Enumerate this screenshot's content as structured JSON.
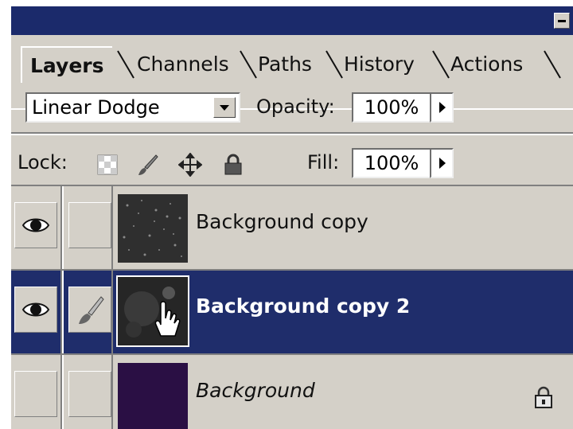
{
  "tabs": [
    {
      "label": "Layers",
      "active": true
    },
    {
      "label": "Channels",
      "active": false
    },
    {
      "label": "Paths",
      "active": false
    },
    {
      "label": "History",
      "active": false
    },
    {
      "label": "Actions",
      "active": false
    }
  ],
  "blend_mode": {
    "value": "Linear Dodge"
  },
  "opacity": {
    "label": "Opacity:",
    "value": "100%"
  },
  "lock": {
    "label": "Lock:"
  },
  "fill": {
    "label": "Fill:",
    "value": "100%"
  },
  "layers": [
    {
      "name": "Background copy",
      "visible": true,
      "selected": false,
      "locked": false,
      "thumb": "dark-texture"
    },
    {
      "name": "Background copy 2",
      "visible": true,
      "selected": true,
      "locked": false,
      "thumb": "dark-texture"
    },
    {
      "name": "Background",
      "visible": false,
      "selected": false,
      "locked": true,
      "thumb": "#2a0f44"
    }
  ],
  "colors": {
    "titlebar": "#1b2a6b",
    "panel": "#d4d0c8",
    "selection": "#1f2d6b",
    "background_swatch": "#2a0f44"
  }
}
